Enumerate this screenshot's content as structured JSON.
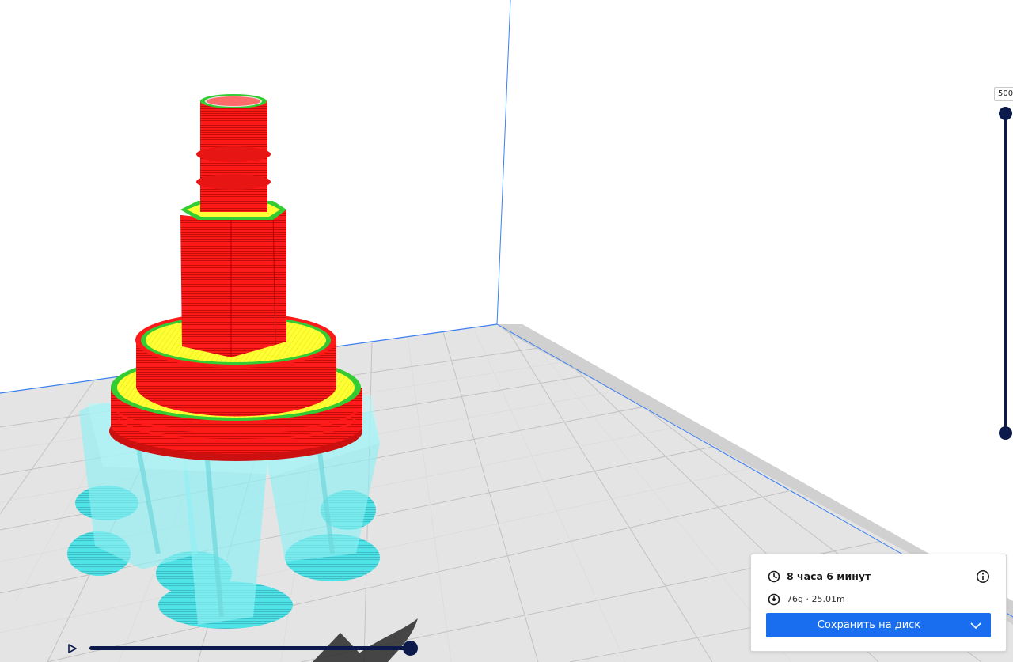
{
  "viewport": {
    "bed_color": "#e8e8e8",
    "grid_color": "#c4c4c4",
    "boundary_color": "#3c7ff0",
    "model": {
      "wall_color": "#ff1a1a",
      "top_skin_color": "#ffff33",
      "inner_wall_color": "#33dd33",
      "support_color": "#55e8ec"
    }
  },
  "layer_slider": {
    "value_label": "500",
    "icon": "vertical-slider"
  },
  "simulation": {
    "play_icon": "play-icon",
    "progress": 1.0
  },
  "print_info": {
    "time": "8 часа 6 минут",
    "material": "76g · 25.01m",
    "save_label": "Сохранить на диск",
    "accent_color": "#196ef0"
  }
}
